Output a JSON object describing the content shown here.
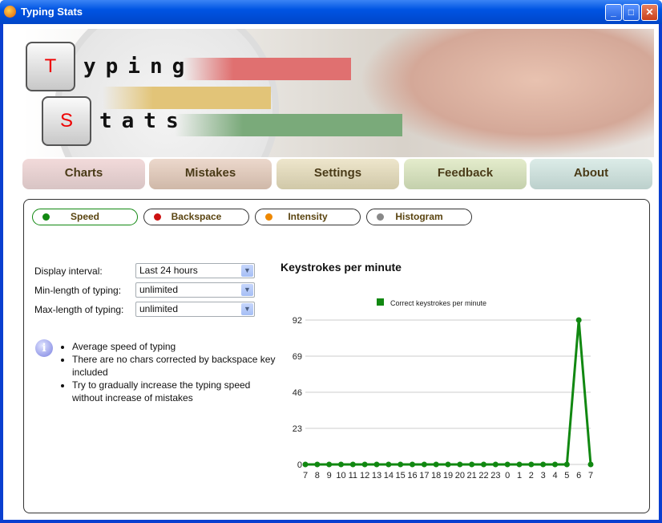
{
  "window": {
    "title": "Typing Stats"
  },
  "logo": {
    "line1_key": "T",
    "line1_rest": "yping",
    "line2_key": "S",
    "line2_rest": "tats"
  },
  "nav": [
    {
      "label": "Charts"
    },
    {
      "label": "Mistakes"
    },
    {
      "label": "Settings"
    },
    {
      "label": "Feedback"
    },
    {
      "label": "About"
    }
  ],
  "tabs": [
    {
      "label": "Speed",
      "color": "#118811",
      "active": true
    },
    {
      "label": "Backspace",
      "color": "#cc1111"
    },
    {
      "label": "Intensity",
      "color": "#ee8800"
    },
    {
      "label": "Histogram",
      "color": "#888888"
    }
  ],
  "filters": [
    {
      "label": "Display interval:",
      "value": "Last 24 hours"
    },
    {
      "label": "Min-length of typing:",
      "value": "unlimited"
    },
    {
      "label": "Max-length of typing:",
      "value": "unlimited"
    }
  ],
  "tips": [
    "Average speed of typing",
    "There are no chars corrected by backspace key included",
    "Try to gradually increase the typing speed without increase of mistakes"
  ],
  "chart_data": {
    "type": "line",
    "title": "Keystrokes per minute",
    "categories": [
      "7",
      "8",
      "9",
      "10",
      "11",
      "12",
      "13",
      "14",
      "15",
      "16",
      "17",
      "18",
      "19",
      "20",
      "21",
      "22",
      "23",
      "0",
      "1",
      "2",
      "3",
      "4",
      "5",
      "6",
      "7"
    ],
    "series": [
      {
        "name": "Correct keystrokes per minute",
        "color": "#118811",
        "values": [
          0,
          0,
          0,
          0,
          0,
          0,
          0,
          0,
          0,
          0,
          0,
          0,
          0,
          0,
          0,
          0,
          0,
          0,
          0,
          0,
          0,
          0,
          0,
          92,
          0
        ]
      }
    ],
    "yticks": [
      0,
      23,
      46,
      69,
      92
    ],
    "ylim": [
      0,
      92
    ],
    "grid": true,
    "legend": "top"
  }
}
